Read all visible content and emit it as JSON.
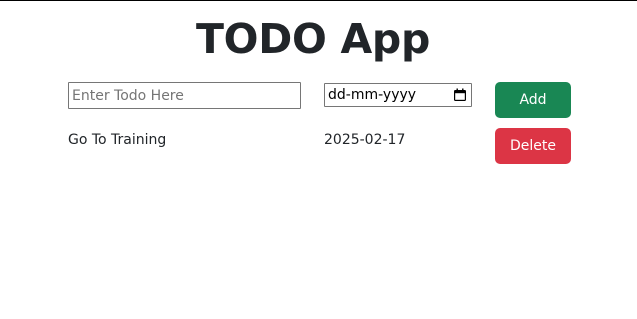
{
  "app": {
    "title": "TODO App"
  },
  "form": {
    "todo_placeholder": "Enter Todo Here",
    "todo_value": "",
    "date_placeholder": "dd-mm-yyyy",
    "add_label": "Add",
    "calendar_icon": "calendar-icon"
  },
  "todos": [
    {
      "title": "Go To Training",
      "date": "2025-02-17",
      "delete_label": "Delete"
    }
  ],
  "colors": {
    "add_button": "#198754",
    "delete_button": "#dc3545",
    "text": "#212529"
  }
}
